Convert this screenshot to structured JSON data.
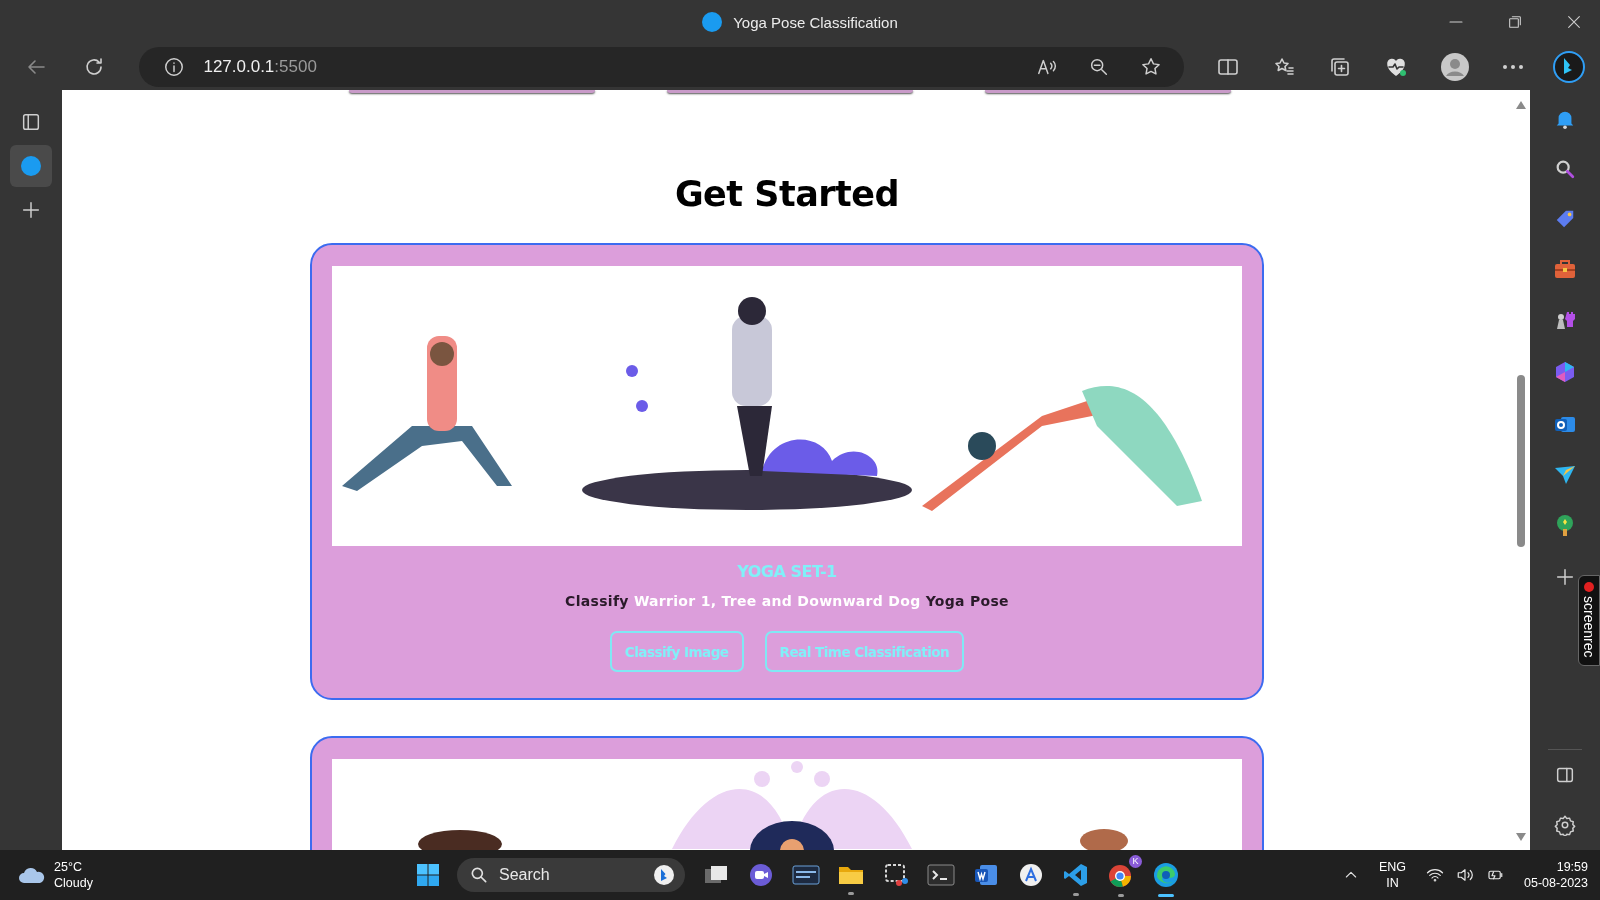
{
  "window": {
    "title": "Yoga Pose Classification"
  },
  "address_bar": {
    "host": "127.0.0.1",
    "port": ":5500"
  },
  "page": {
    "heading": "Get Started",
    "cards": [
      {
        "picture": {
          "kind": "picture"
        },
        "title": "YOGA SET-1",
        "description": [
          {
            "text": "Classify ",
            "highlight": false
          },
          {
            "text": "Warrior 1, Tree and Downward Dog",
            "highlight": true
          },
          {
            "text": " Yoga Pose",
            "highlight": false
          }
        ],
        "buttons": [
          "Classify Image",
          "Real Time Classification"
        ]
      },
      {
        "picture": {
          "kind": "picture"
        }
      }
    ]
  },
  "side_panel": {
    "recorder_tab": "screenrec"
  },
  "taskbar": {
    "weather": {
      "temperature": "25°C",
      "condition": "Cloudy"
    },
    "search": {
      "placeholder": "Search"
    },
    "apps_badge": "K",
    "language": {
      "code": "ENG",
      "region": "IN"
    },
    "clock": {
      "time": "19:59",
      "date": "05-08-2023"
    }
  }
}
